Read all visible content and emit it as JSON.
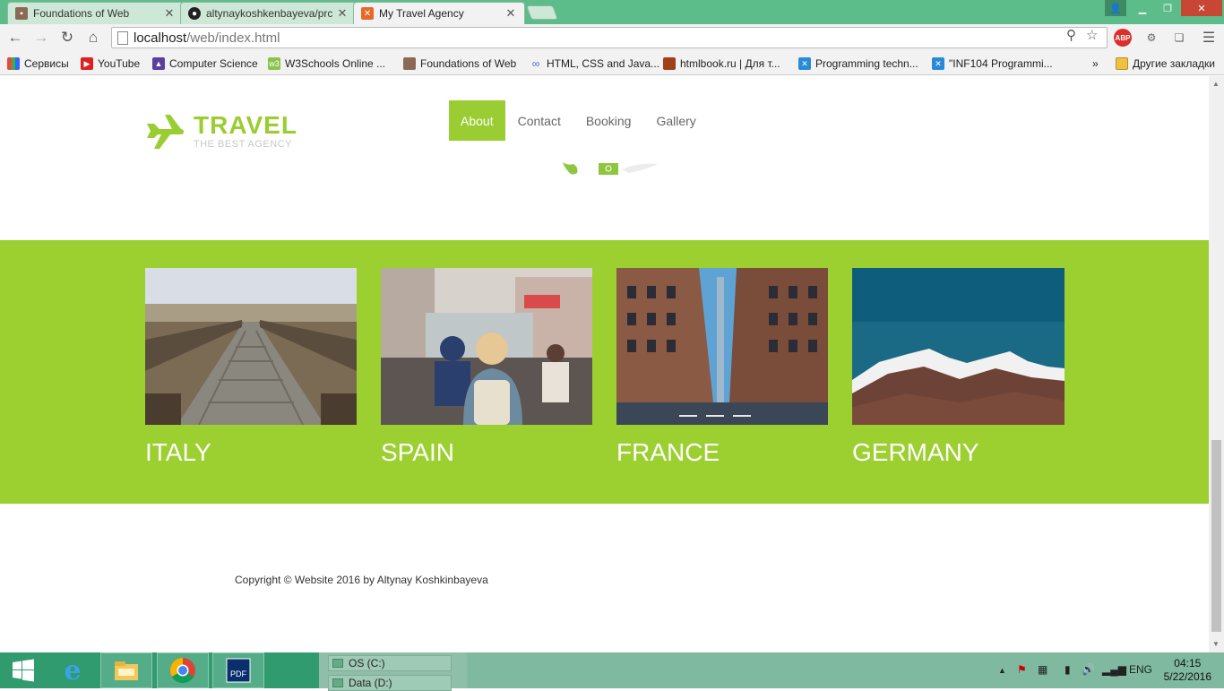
{
  "browser": {
    "tabs": [
      {
        "title": "Foundations of Web",
        "active": false
      },
      {
        "title": "altynaykoshkenbayeva/prc",
        "active": false
      },
      {
        "title": "My Travel Agency",
        "active": true
      }
    ],
    "url_host": "localhost",
    "url_path": "/web/index.html",
    "bookmarks": [
      {
        "label": "Сервисы",
        "icon": "apps-grid-icon"
      },
      {
        "label": "YouTube",
        "icon": "youtube-icon"
      },
      {
        "label": "Computer Science",
        "icon": "cs-icon"
      },
      {
        "label": "W3Schools Online ...",
        "icon": "w3schools-icon"
      },
      {
        "label": "Foundations of Web",
        "icon": "page-icon"
      },
      {
        "label": "HTML, CSS and Java...",
        "icon": "infinity-icon"
      },
      {
        "label": "htmlbook.ru | Для т...",
        "icon": "htmlbook-icon"
      },
      {
        "label": "Programming techn...",
        "icon": "programming-icon"
      },
      {
        "label": "\"INF104 Programmi...",
        "icon": "programming-icon"
      }
    ],
    "bookmarks_overflow": "»",
    "other_bookmarks": "Другие закладки",
    "extension_abp": "ABP"
  },
  "site": {
    "logo_title": "TRAVEL",
    "logo_subtitle": "THE BEST AGENCY",
    "nav": [
      {
        "label": "About",
        "active": true
      },
      {
        "label": "Contact",
        "active": false
      },
      {
        "label": "Booking",
        "active": false
      },
      {
        "label": "Gallery",
        "active": false
      }
    ],
    "destinations": [
      {
        "name": "ITALY",
        "photo": "wooden-boardwalk"
      },
      {
        "name": "SPAIN",
        "photo": "street-traffic"
      },
      {
        "name": "FRANCE",
        "photo": "city-street"
      },
      {
        "name": "GERMANY",
        "photo": "mountains"
      }
    ],
    "copyright": "Copyright © Website 2016 by Altynay Koshkinbayeva"
  },
  "taskbar": {
    "drives": [
      "OS (C:)",
      "Data (D:)"
    ],
    "language": "ENG",
    "time": "04:15",
    "date": "5/22/2016"
  },
  "colors": {
    "accent_green": "#9acd32",
    "section_green": "#9ccf30",
    "chrome_frame": "#5dbd8a",
    "taskbar": "#2f9b6e"
  }
}
